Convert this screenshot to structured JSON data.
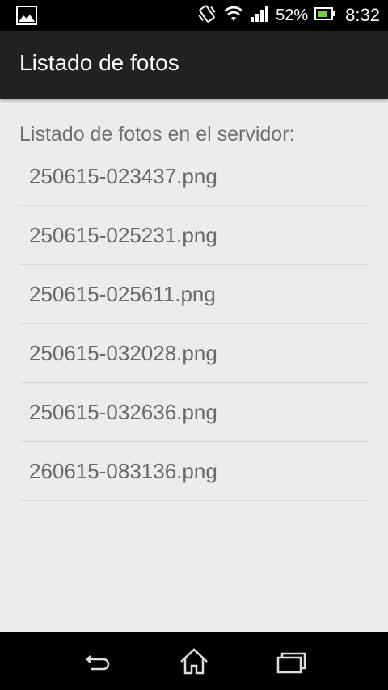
{
  "status_bar": {
    "notification_icon": "gallery-image-icon",
    "vibrate_icon": "vibrate-icon",
    "wifi_icon": "wifi-icon",
    "signal_icon": "signal-icon",
    "battery_percent": "52%",
    "battery_icon": "battery-icon",
    "time": "8:32"
  },
  "action_bar": {
    "title": "Listado de fotos"
  },
  "content": {
    "heading": "Listado de fotos en el servidor:",
    "files": [
      "250615-023437.png",
      "250615-025231.png",
      "250615-025611.png",
      "250615-032028.png",
      "250615-032636.png",
      "260615-083136.png"
    ]
  },
  "nav_bar": {
    "back_icon": "back-icon",
    "home_icon": "home-icon",
    "recent_icon": "recent-apps-icon"
  },
  "colors": {
    "status_bar_bg": "#000000",
    "action_bar_bg": "#222222",
    "content_bg": "#ececec",
    "text_gray": "#6a6a6a",
    "divider": "#d8d8d8"
  }
}
